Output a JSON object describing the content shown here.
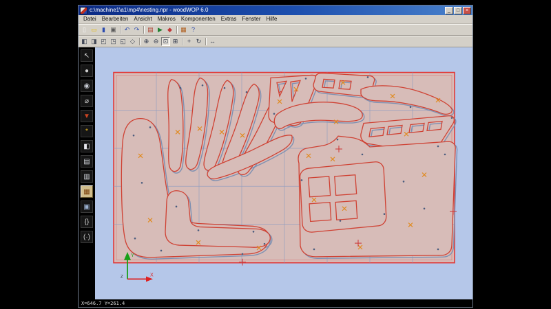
{
  "window": {
    "title": "c:\\machine1\\a1\\mp4\\nesting.npr - woodWOP 6.0",
    "controls": [
      {
        "name": "minimize",
        "glyph": "_"
      },
      {
        "name": "maximize",
        "glyph": "□"
      },
      {
        "name": "close",
        "glyph": "×"
      }
    ]
  },
  "menu": {
    "items": [
      "Datei",
      "Bearbeiten",
      "Ansicht",
      "Makros",
      "Komponenten",
      "Extras",
      "Fenster",
      "Hilfe"
    ]
  },
  "toolbar_main": {
    "icons": [
      {
        "name": "new-file",
        "glyph": "▯",
        "color": "#f4f4f4"
      },
      {
        "name": "open-file",
        "glyph": "▭",
        "color": "#e6b800"
      },
      {
        "name": "save-file",
        "glyph": "▮",
        "color": "#2b4bb0"
      },
      {
        "name": "print",
        "glyph": "▣",
        "color": "#5a5a5a"
      },
      {
        "separator": true
      },
      {
        "name": "undo",
        "glyph": "↶",
        "color": "#2b4bb0"
      },
      {
        "name": "redo",
        "glyph": "↷",
        "color": "#2b4bb0"
      },
      {
        "separator": true
      },
      {
        "name": "mpr-editor",
        "glyph": "▤",
        "color": "#b04030"
      },
      {
        "name": "simulation",
        "glyph": "▶",
        "color": "#208030"
      },
      {
        "name": "machine-run",
        "glyph": "◆",
        "color": "#c03838"
      },
      {
        "separator": true
      },
      {
        "name": "nesting",
        "glyph": "▦",
        "color": "#b06020"
      },
      {
        "name": "help",
        "glyph": "?",
        "color": "#2b4bb0"
      }
    ]
  },
  "toolbar_view": {
    "icons": [
      {
        "name": "window-layout",
        "glyph": "◧",
        "color": "#444a58"
      },
      {
        "name": "window-split",
        "glyph": "◨",
        "color": "#444a58"
      },
      {
        "name": "view-front",
        "glyph": "◰",
        "color": "#444a58"
      },
      {
        "name": "view-side",
        "glyph": "◳",
        "color": "#444a58"
      },
      {
        "name": "view-top",
        "glyph": "◱",
        "color": "#444a58"
      },
      {
        "name": "view-3d",
        "glyph": "◇",
        "color": "#444a58"
      },
      {
        "separator": true
      },
      {
        "name": "zoom-in",
        "glyph": "⊕",
        "color": "#30384a"
      },
      {
        "name": "zoom-out",
        "glyph": "⊖",
        "color": "#30384a"
      },
      {
        "name": "zoom-window",
        "glyph": "⊡",
        "color": "#30384a",
        "active": true
      },
      {
        "name": "zoom-fit",
        "glyph": "⊞",
        "color": "#30384a"
      },
      {
        "separator": true
      },
      {
        "name": "pan",
        "glyph": "+",
        "color": "#30384a"
      },
      {
        "name": "redraw",
        "glyph": "↻",
        "color": "#30384a"
      },
      {
        "separator": true
      },
      {
        "name": "measure",
        "glyph": "↔",
        "color": "#30384a"
      }
    ]
  },
  "sidebar": {
    "icons": [
      {
        "name": "select-tool",
        "glyph": "↖",
        "color": "#e0e0e0"
      },
      {
        "name": "drilling-tool",
        "glyph": "●",
        "color": "#d0d0d0"
      },
      {
        "name": "sawing-tool",
        "glyph": "◉",
        "color": "#c8ccd4"
      },
      {
        "name": "routing-tool",
        "glyph": "⌀",
        "color": "#d8d8d8"
      },
      {
        "name": "milling-tool",
        "glyph": "▼",
        "color": "#cc4422"
      },
      {
        "name": "settings-gear",
        "glyph": "*",
        "color": "#e8b820"
      },
      {
        "name": "component-tool",
        "glyph": "◧",
        "color": "#e8e8f0"
      },
      {
        "name": "document-tool",
        "glyph": "▤",
        "color": "#d8dce2"
      },
      {
        "name": "report-tool",
        "glyph": "▥",
        "color": "#d8dce2"
      },
      {
        "name": "nesting-tool",
        "glyph": "▦",
        "color": "#7a420e",
        "active": true
      },
      {
        "name": "parts-list-tool",
        "glyph": "▣",
        "color": "#9ab0d0"
      },
      {
        "name": "variables-tool",
        "glyph": "{}",
        "color": "#cccccc"
      },
      {
        "name": "comment-tool",
        "glyph": "(·)",
        "color": "#cccccc"
      }
    ]
  },
  "canvas": {
    "background": "#b5c7e9",
    "board_fill": "#d7bcb8",
    "board_border": "#e03a3a",
    "grid_color": "#8d9cc0",
    "part_outline": "#cf4133",
    "blank_outline": "#7e90b2",
    "marker_color": "#e08a1e",
    "axis_x_color": "#dd2222",
    "axis_y_color": "#18a018",
    "axis_labels": {
      "x": "X",
      "y": "Y",
      "z": "Z"
    }
  },
  "statusbar": {
    "coordinates": "X=646.7  Y=261.4"
  }
}
